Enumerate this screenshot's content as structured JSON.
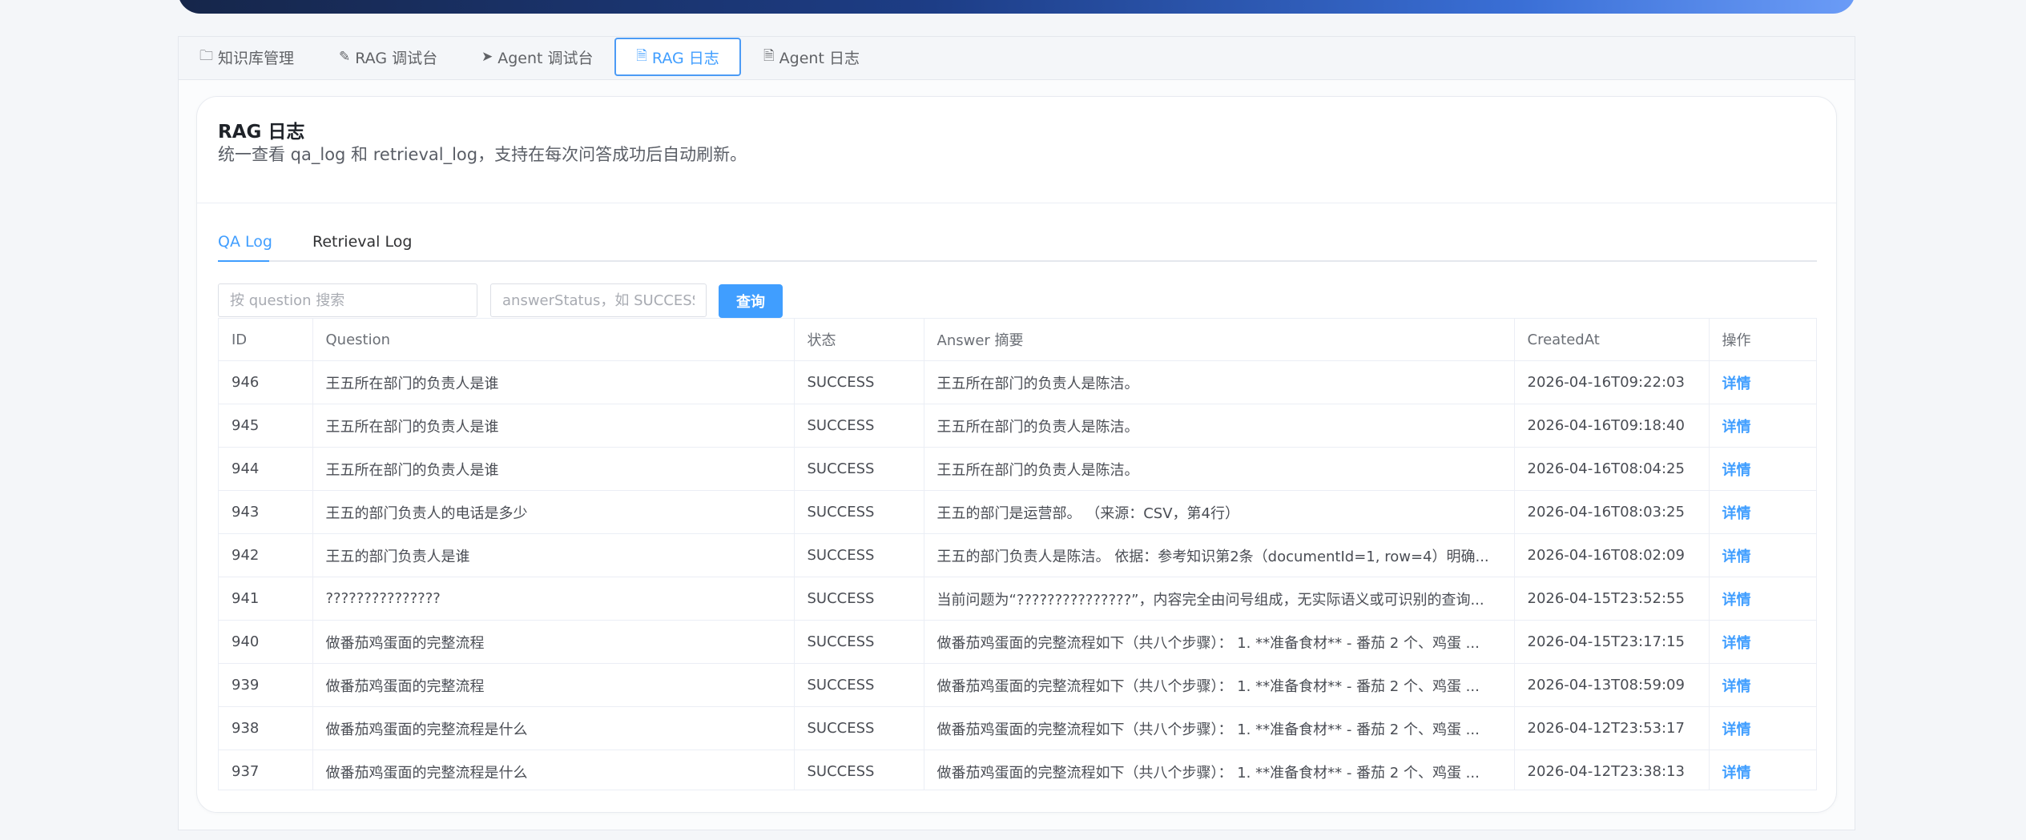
{
  "tabs": [
    {
      "icon": "🗀",
      "label": "知识库管理"
    },
    {
      "icon": "✎",
      "label": "RAG 调试台"
    },
    {
      "icon": "➤",
      "label": "Agent 调试台"
    },
    {
      "icon": "🗎",
      "label": "RAG 日志"
    },
    {
      "icon": "🗎",
      "label": "Agent 日志"
    }
  ],
  "card": {
    "title": "RAG 日志",
    "subtitle": "统一查看 qa_log 和 retrieval_log，支持在每次问答成功后自动刷新。"
  },
  "subtabs": {
    "qa": "QA Log",
    "retrieval": "Retrieval Log"
  },
  "search": {
    "question_placeholder": "按 question 搜索",
    "status_placeholder": "answerStatus，如 SUCCESS",
    "query_label": "查询"
  },
  "table": {
    "headers": {
      "id": "ID",
      "question": "Question",
      "status": "状态",
      "answer": "Answer 摘要",
      "created": "CreatedAt",
      "action": "操作"
    },
    "rows": [
      {
        "id": "946",
        "question": "王五所在部门的负责人是谁",
        "status": "SUCCESS",
        "answer": "王五所在部门的负责人是陈洁。",
        "created": "2026-04-16T09:22:03",
        "action": "详情"
      },
      {
        "id": "945",
        "question": "王五所在部门的负责人是谁",
        "status": "SUCCESS",
        "answer": "王五所在部门的负责人是陈洁。",
        "created": "2026-04-16T09:18:40",
        "action": "详情"
      },
      {
        "id": "944",
        "question": "王五所在部门的负责人是谁",
        "status": "SUCCESS",
        "answer": "王五所在部门的负责人是陈洁。",
        "created": "2026-04-16T08:04:25",
        "action": "详情"
      },
      {
        "id": "943",
        "question": "王五的部门负责人的电话是多少",
        "status": "SUCCESS",
        "answer": "王五的部门是运营部。 （来源：CSV，第4行）",
        "created": "2026-04-16T08:03:25",
        "action": "详情"
      },
      {
        "id": "942",
        "question": "王五的部门负责人是谁",
        "status": "SUCCESS",
        "answer": "王五的部门负责人是陈洁。 依据：参考知识第2条（documentId=1, row=4）明确...",
        "created": "2026-04-16T08:02:09",
        "action": "详情"
      },
      {
        "id": "941",
        "question": "???????????????",
        "status": "SUCCESS",
        "answer": "当前问题为“???????????????”，内容完全由问号组成，无实际语义或可识别的查询...",
        "created": "2026-04-15T23:52:55",
        "action": "详情"
      },
      {
        "id": "940",
        "question": "做番茄鸡蛋面的完整流程",
        "status": "SUCCESS",
        "answer": "做番茄鸡蛋面的完整流程如下（共八个步骤）： 1. **准备食材** - 番茄 2 个、鸡蛋 ...",
        "created": "2026-04-15T23:17:15",
        "action": "详情"
      },
      {
        "id": "939",
        "question": "做番茄鸡蛋面的完整流程",
        "status": "SUCCESS",
        "answer": "做番茄鸡蛋面的完整流程如下（共八个步骤）： 1. **准备食材** - 番茄 2 个、鸡蛋 ...",
        "created": "2026-04-13T08:59:09",
        "action": "详情"
      },
      {
        "id": "938",
        "question": "做番茄鸡蛋面的完整流程是什么",
        "status": "SUCCESS",
        "answer": "做番茄鸡蛋面的完整流程如下（共八个步骤）： 1. **准备食材** - 番茄 2 个、鸡蛋 ...",
        "created": "2026-04-12T23:53:17",
        "action": "详情"
      },
      {
        "id": "937",
        "question": "做番茄鸡蛋面的完整流程是什么",
        "status": "SUCCESS",
        "answer": "做番茄鸡蛋面的完整流程如下（共八个步骤）： 1. **准备食材** - 番茄 2 个、鸡蛋 ...",
        "created": "2026-04-12T23:38:13",
        "action": "详情"
      }
    ]
  },
  "colors": {
    "accent": "#409eff",
    "banner_start": "#16264a",
    "banner_end": "#6b9cf7"
  }
}
